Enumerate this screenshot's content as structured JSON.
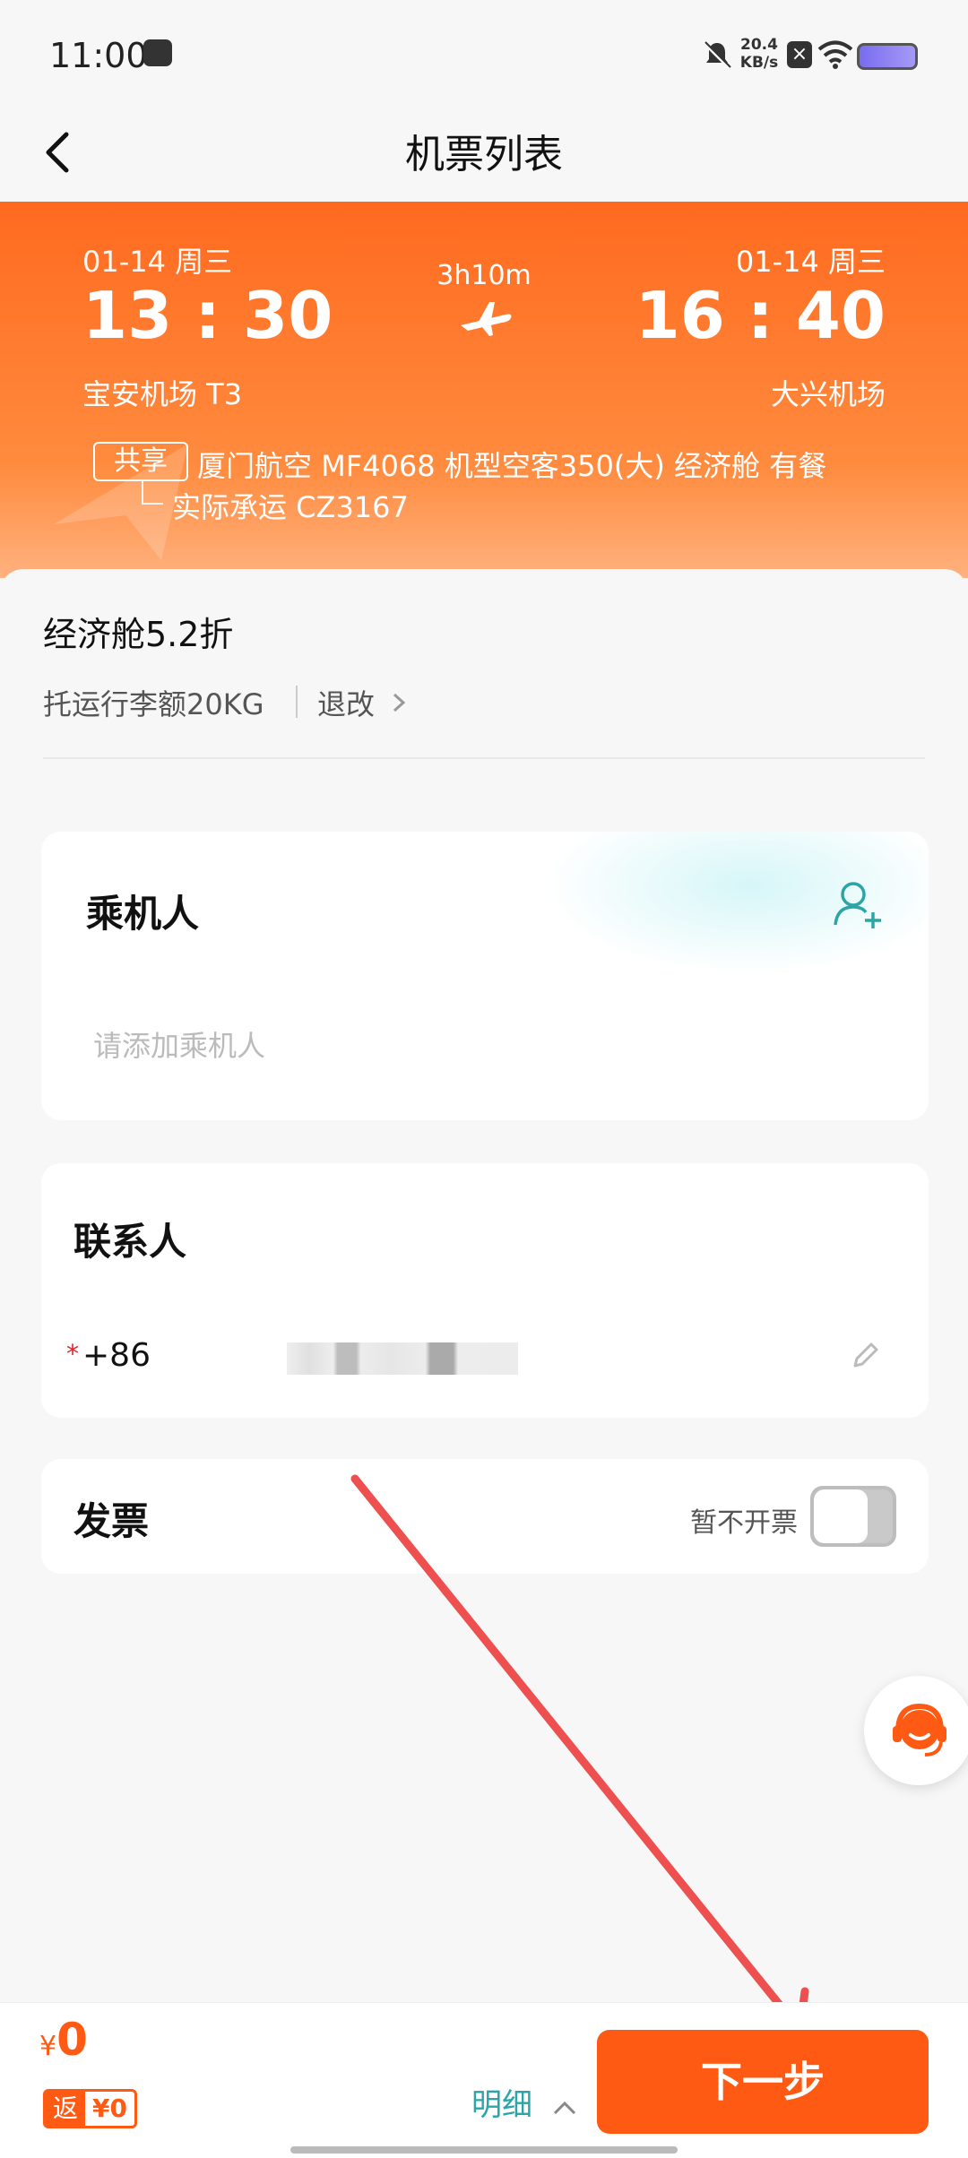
{
  "status_bar": {
    "time": "11:00",
    "network_speed_top": "20.4",
    "network_speed_bottom": "KB/s"
  },
  "header": {
    "title": "机票列表"
  },
  "flight": {
    "depart_date": "01-14 周三",
    "depart_time": "13 : 30",
    "depart_airport": "宝安机场 T3",
    "duration": "3h10m",
    "arrive_date": "01-14 周三",
    "arrive_time": "16 : 40",
    "arrive_airport": "大兴机场",
    "share_badge": "共享",
    "flight_info": "厦门航空 MF4068  机型空客350(大) 经济舱  有餐",
    "operated_by": "实际承运 CZ3167"
  },
  "cabin": {
    "title": "经济舱5.2折",
    "baggage": "托运行李额20KG",
    "refund_change": "退改"
  },
  "passenger": {
    "title": "乘机人",
    "placeholder": "请添加乘机人"
  },
  "contact": {
    "title": "联系人",
    "required_mark": "*",
    "country_code": "+86"
  },
  "invoice": {
    "title": "发票",
    "status": "暂不开票"
  },
  "footer": {
    "currency_symbol": "¥",
    "price": "0",
    "rebate_label": "返",
    "rebate_value": "¥0",
    "detail_label": "明细",
    "next_label": "下一步"
  },
  "colors": {
    "accent": "#ff5a14",
    "teal": "#2aa6a6"
  }
}
